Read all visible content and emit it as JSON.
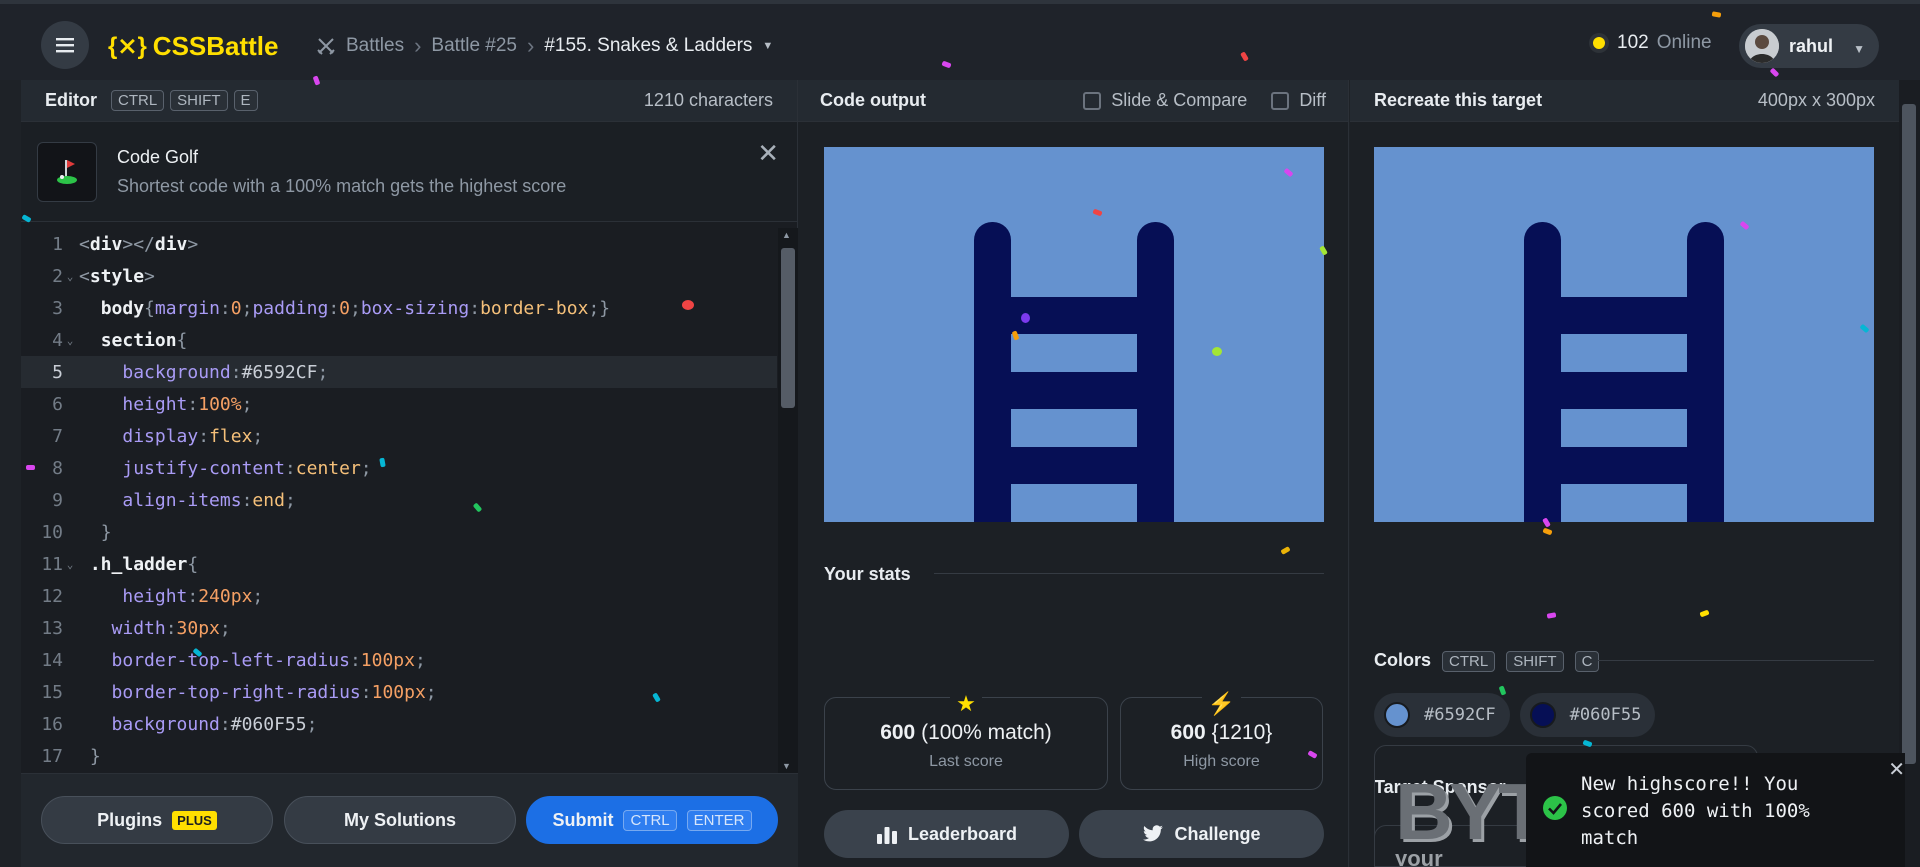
{
  "header": {
    "brand": "CSSBattle",
    "crumbs": [
      "Battles",
      "Battle #25",
      "#155. Snakes & Ladders"
    ],
    "online_count": "102",
    "online_label": "Online",
    "user_name": "rahul"
  },
  "editor": {
    "title": "Editor",
    "shortcut": [
      "CTRL",
      "SHIFT",
      "E"
    ],
    "char_count": "1210 characters",
    "golf_title": "Code Golf",
    "golf_desc": "Shortest code with a 100% match gets the highest score",
    "line_numbers": [
      "1",
      "2",
      "3",
      "4",
      "5",
      "6",
      "7",
      "8",
      "9",
      "10",
      "11",
      "12",
      "13",
      "14",
      "15",
      "16",
      "17"
    ],
    "active_line": 5
  },
  "actions": {
    "plugins": "Plugins",
    "plugins_tag": "PLUS",
    "solutions": "My Solutions",
    "submit": "Submit",
    "submit_keys": [
      "CTRL",
      "ENTER"
    ]
  },
  "output": {
    "title": "Code output",
    "slide_compare": "Slide & Compare",
    "diff": "Diff",
    "stats_title": "Your stats",
    "last_score": "600",
    "last_match": "(100% match)",
    "last_label": "Last score",
    "high_score": "600",
    "high_chars": "{1210}",
    "high_label": "High score",
    "leaderboard": "Leaderboard",
    "challenge": "Challenge"
  },
  "target": {
    "title": "Recreate this target",
    "size": "400px x 300px",
    "colors_title": "Colors",
    "colors_keys": [
      "CTRL",
      "SHIFT",
      "C"
    ],
    "colors": [
      "#6592CF",
      "#060F55"
    ],
    "sponsor_title": "Target Sponsor",
    "sponsor_logo": "BYT",
    "sponsor_sub": "your"
  },
  "toast": {
    "message": "New highscore!! You scored 600 with 100% match"
  },
  "palette": {
    "background": "#6592CF",
    "ladder": "#060F55",
    "accent": "#FFDF00",
    "submit": "#1C6FE5"
  }
}
